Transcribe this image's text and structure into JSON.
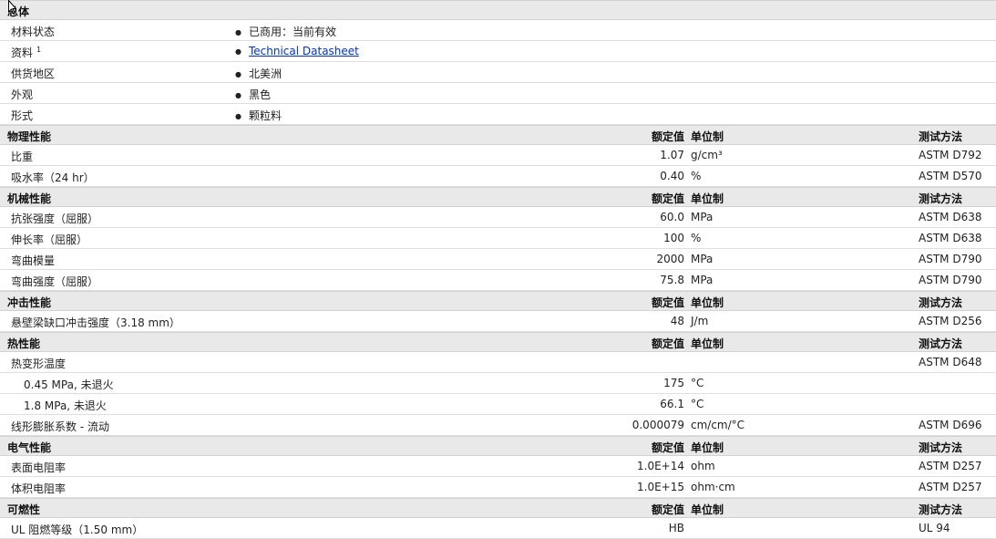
{
  "general": {
    "title": "总体",
    "rows": [
      {
        "label": "材料状态",
        "value": "已商用：当前有效"
      },
      {
        "label": "资料",
        "sup": "1",
        "value": "Technical Datasheet",
        "link": true
      },
      {
        "label": "供货地区",
        "value": "北美洲"
      },
      {
        "label": "外观",
        "value": "黑色"
      },
      {
        "label": "形式",
        "value": "颗粒料"
      }
    ]
  },
  "columns": {
    "value": "额定值",
    "unit": "单位制",
    "test": "测试方法"
  },
  "sections": [
    {
      "title": "物理性能",
      "rows": [
        {
          "label": "比重",
          "value": "1.07",
          "unit": "g/cm³",
          "test": "ASTM D792"
        },
        {
          "label": "吸水率（24 hr）",
          "value": "0.40",
          "unit": "%",
          "test": "ASTM D570"
        }
      ]
    },
    {
      "title": "机械性能",
      "rows": [
        {
          "label": "抗张强度（屈服）",
          "value": "60.0",
          "unit": "MPa",
          "test": "ASTM D638"
        },
        {
          "label": "伸长率（屈服）",
          "value": "100",
          "unit": "%",
          "test": "ASTM D638"
        },
        {
          "label": "弯曲模量",
          "value": "2000",
          "unit": "MPa",
          "test": "ASTM D790"
        },
        {
          "label": "弯曲强度（屈服）",
          "value": "75.8",
          "unit": "MPa",
          "test": "ASTM D790"
        }
      ]
    },
    {
      "title": "冲击性能",
      "rows": [
        {
          "label": "悬壁梁缺口冲击强度（3.18 mm）",
          "value": "48",
          "unit": "J/m",
          "test": "ASTM D256"
        }
      ]
    },
    {
      "title": "热性能",
      "rows": [
        {
          "label": "热变形温度",
          "value": "",
          "unit": "",
          "test": "ASTM D648"
        },
        {
          "label": "0.45 MPa, 未退火",
          "value": "175",
          "unit": "°C",
          "test": "",
          "sub": true
        },
        {
          "label": "1.8 MPa, 未退火",
          "value": "66.1",
          "unit": "°C",
          "test": "",
          "sub": true
        },
        {
          "label": "线形膨胀系数 - 流动",
          "value": "0.000079",
          "unit": "cm/cm/°C",
          "test": "ASTM D696"
        }
      ]
    },
    {
      "title": "电气性能",
      "rows": [
        {
          "label": "表面电阻率",
          "value": "1.0E+14",
          "unit": "ohm",
          "test": "ASTM D257"
        },
        {
          "label": "体积电阻率",
          "value": "1.0E+15",
          "unit": "ohm·cm",
          "test": "ASTM D257"
        }
      ]
    },
    {
      "title": "可燃性",
      "rows": [
        {
          "label": "UL 阻燃等级（1.50 mm）",
          "value": "HB",
          "unit": "",
          "test": "UL 94"
        }
      ]
    }
  ]
}
